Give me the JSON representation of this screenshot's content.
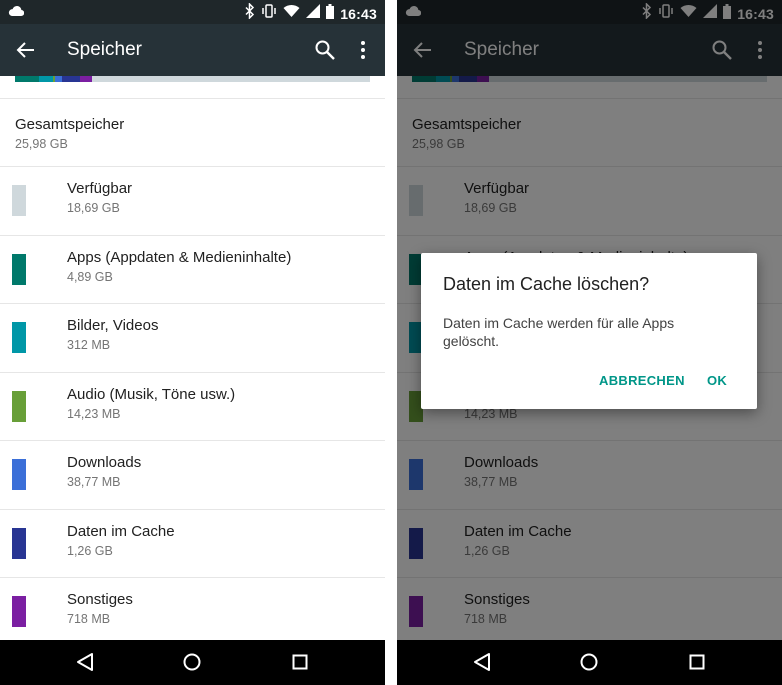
{
  "status_bar": {
    "time": "16:43",
    "icons": [
      "cloud-icon",
      "bluetooth-icon",
      "vibrate-icon",
      "wifi-icon",
      "signal-icon",
      "battery-icon"
    ]
  },
  "toolbar": {
    "title": "Speicher",
    "back_icon": "arrow-back-icon",
    "search_icon": "search-icon",
    "more_icon": "more-vert-icon"
  },
  "total": {
    "label": "Gesamtspeicher",
    "value": "25,98 GB"
  },
  "usage_bar_colors": [
    "#00796b",
    "#0097a7",
    "#689f38",
    "#3b6fd8",
    "#283593",
    "#7b1fa2"
  ],
  "items": [
    {
      "label": "Verfügbar",
      "size": "18,69 GB",
      "color": "#cfd8dc"
    },
    {
      "label": "Apps (Appdaten & Medieninhalte)",
      "size": "4,89 GB",
      "color": "#00796b"
    },
    {
      "label": "Bilder, Videos",
      "size": "312 MB",
      "color": "#0097a7"
    },
    {
      "label": "Audio (Musik, Töne usw.)",
      "size": "14,23 MB",
      "color": "#689f38"
    },
    {
      "label": "Downloads",
      "size": "38,77 MB",
      "color": "#3b6fd8"
    },
    {
      "label": "Daten im Cache",
      "size": "1,26 GB",
      "color": "#283593"
    },
    {
      "label": "Sonstiges",
      "size": "718 MB",
      "color": "#7b1fa2"
    }
  ],
  "dialog": {
    "title": "Daten im Cache löschen?",
    "message": "Daten im Cache werden für alle Apps gelöscht.",
    "cancel_label": "ABBRECHEN",
    "ok_label": "OK"
  },
  "nav_bar": {
    "icons": [
      "nav-back-icon",
      "nav-home-icon",
      "nav-recents-icon"
    ]
  },
  "colors": {
    "status_bar": "#1f272a",
    "toolbar": "#263238",
    "accent": "#009688"
  }
}
